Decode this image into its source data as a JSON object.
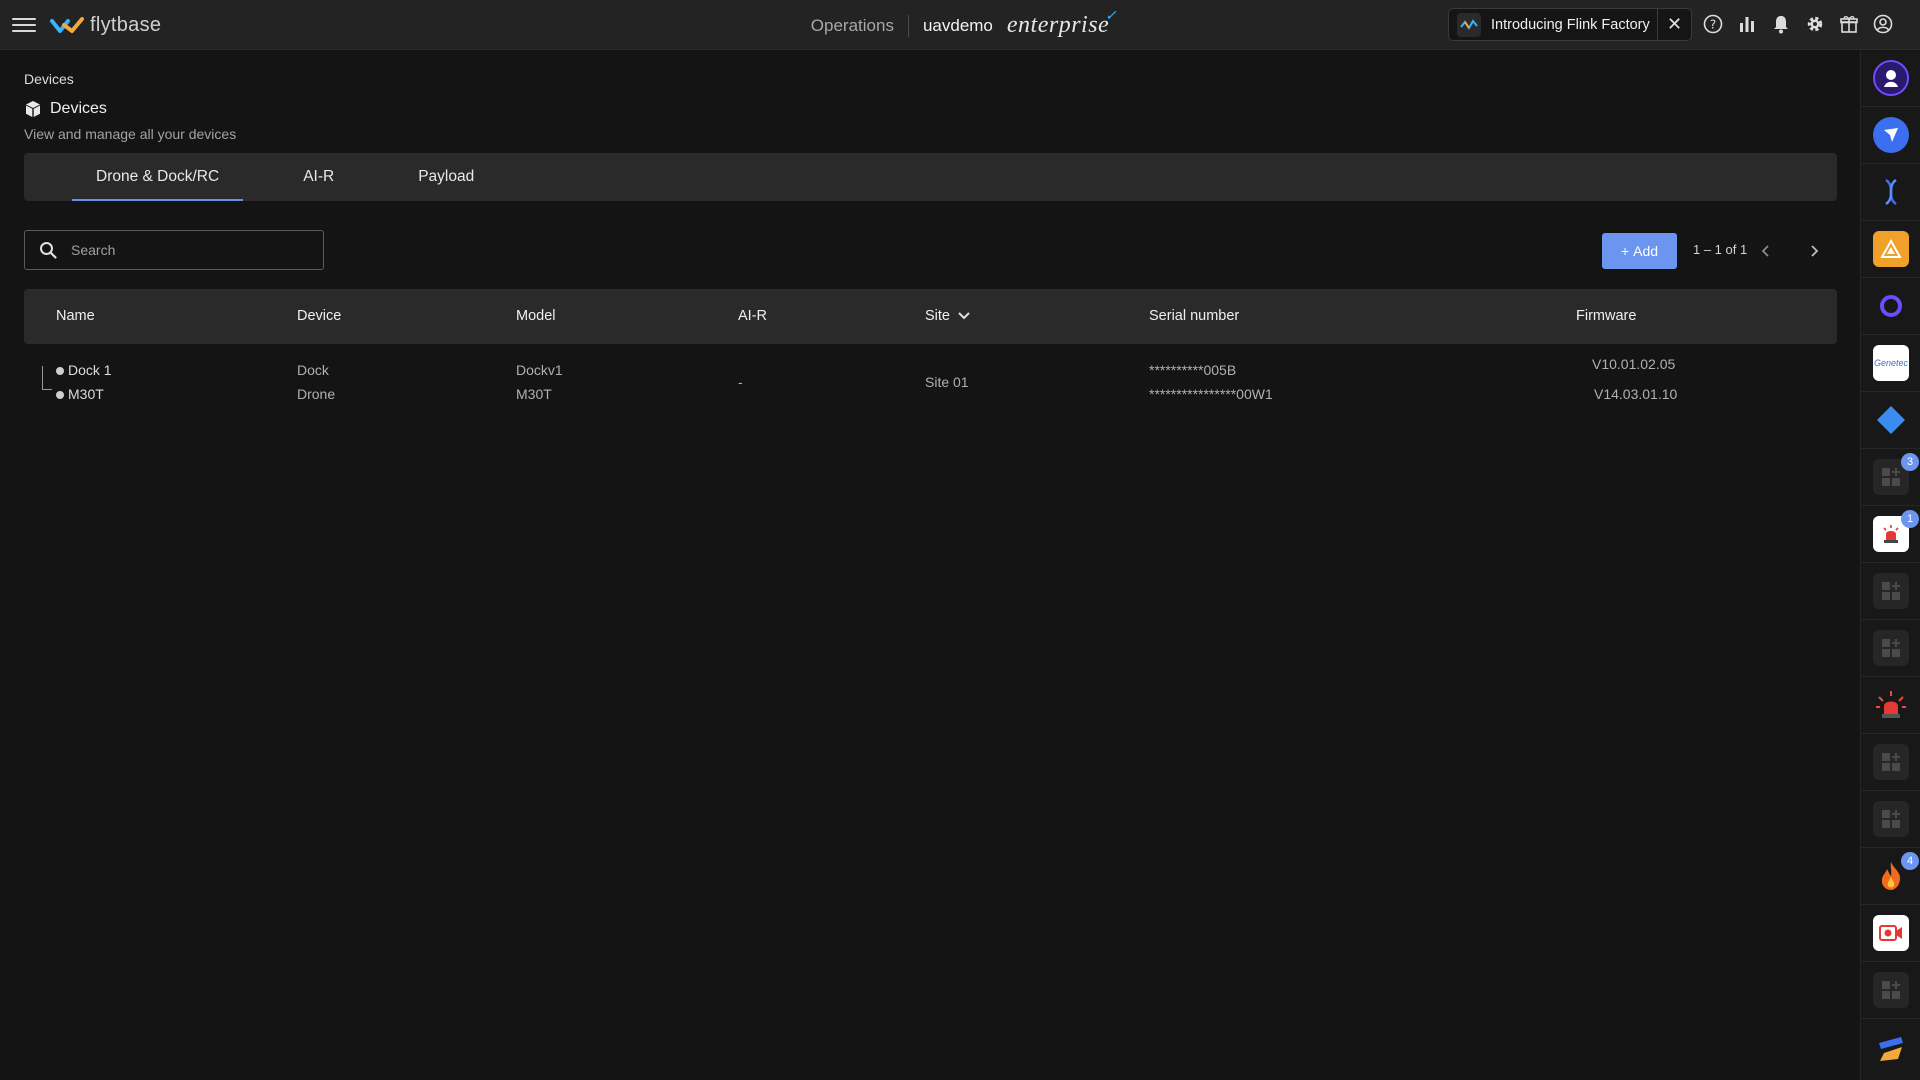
{
  "topbar": {
    "logo_text": "flytbase",
    "operations": "Operations",
    "org": "uavdemo",
    "edition": "enterprise",
    "announcement": "Introducing Flink Factory",
    "icons": [
      "help-icon",
      "analytics-icon",
      "bell-icon",
      "gear-icon",
      "gift-icon",
      "account-icon"
    ]
  },
  "page": {
    "breadcrumb": "Devices",
    "title": "Devices",
    "subtitle": "View and manage all your devices"
  },
  "tabs": [
    {
      "label": "Drone & Dock/RC",
      "active": true
    },
    {
      "label": "AI-R",
      "active": false
    },
    {
      "label": "Payload",
      "active": false
    }
  ],
  "search": {
    "placeholder": "Search"
  },
  "toolbar": {
    "add_label": "Add",
    "pagination": "1 – 1 of 1"
  },
  "table": {
    "headers": {
      "name": "Name",
      "device": "Device",
      "model": "Model",
      "air": "AI-R",
      "site": "Site",
      "serial": "Serial number",
      "firmware": "Firmware"
    },
    "rows": [
      {
        "names": [
          "Dock 1",
          "M30T"
        ],
        "devices": [
          "Dock",
          "Drone"
        ],
        "models": [
          "Dockv1",
          "M30T"
        ],
        "air": "-",
        "site": "Site 01",
        "serials": [
          "**********005B",
          "****************00W1"
        ],
        "firmwares": [
          "V10.01.02.05",
          "V14.03.01.10"
        ]
      }
    ]
  },
  "rail": {
    "badges": {
      "item8": "3",
      "item9": "1",
      "item15": "4"
    },
    "items": [
      "flytbase-avatar-icon",
      "send-icon",
      "dna-icon",
      "warning-icon",
      "circle-app-icon",
      "genetec-icon",
      "diamond-icon",
      "grid-add-icon",
      "alarm-icon",
      "grid-add-icon",
      "grid-add-icon",
      "siren-icon",
      "grid-add-icon",
      "grid-add-icon",
      "fire-icon",
      "camera-record-icon",
      "grid-add-icon",
      "plugin-icon"
    ],
    "genetec_label": "Genetec"
  },
  "colors": {
    "accent": "#6b95ee",
    "background": "#141414",
    "panel": "#2a2a2a"
  }
}
